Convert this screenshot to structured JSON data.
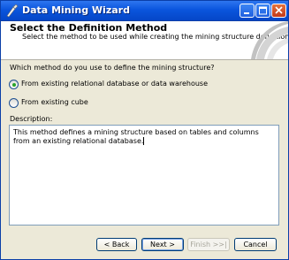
{
  "window": {
    "title": "Data Mining Wizard",
    "controls": [
      "minimize-icon",
      "maximize-icon",
      "close-icon"
    ]
  },
  "header": {
    "title": "Select the Definition Method",
    "subtitle": "Select the method to be used while creating the mining structure definition."
  },
  "form": {
    "question": "Which method do you use to define the mining structure?",
    "options": [
      {
        "label": "From existing relational database or data warehouse",
        "selected": true
      },
      {
        "label": "From existing cube",
        "selected": false
      }
    ],
    "description_label": "Description:",
    "description_text": "This method defines a mining structure based on tables and columns from an existing relational database."
  },
  "buttons": {
    "back": "< Back",
    "next": "Next >",
    "finish": "Finish >>|",
    "cancel": "Cancel"
  },
  "colors": {
    "titlebar": "#0a55dd",
    "face": "#ece9d8",
    "radio_dot": "#28a428"
  }
}
